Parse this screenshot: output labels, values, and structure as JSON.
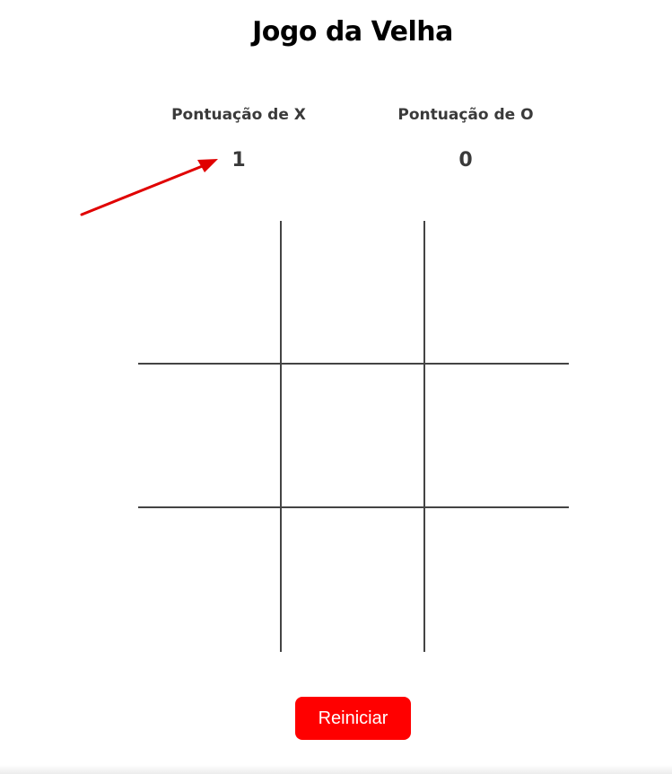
{
  "title": "Jogo da Velha",
  "scores": {
    "x": {
      "label": "Pontuação de X",
      "value": "1"
    },
    "o": {
      "label": "Pontuação de O",
      "value": "0"
    }
  },
  "board": {
    "cells": [
      "",
      "",
      "",
      "",
      "",
      "",
      "",
      "",
      ""
    ]
  },
  "restart_label": "Reiniciar",
  "colors": {
    "accent": "#ff0000",
    "annotation_arrow": "#e00000",
    "grid_line": "#444444",
    "score_text": "#3a3a3a"
  }
}
